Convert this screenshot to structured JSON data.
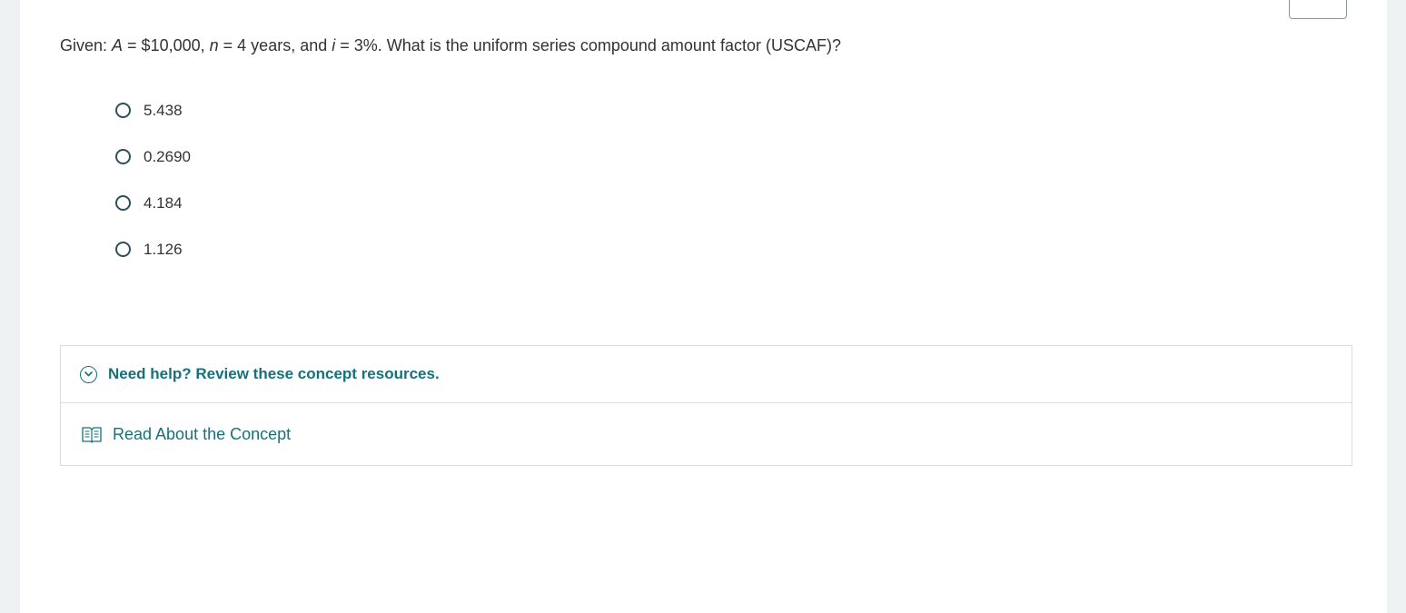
{
  "question": {
    "prefix": "Given: ",
    "var_a": "A",
    "part_a": " = $10,000, ",
    "var_n": "n",
    "part_n": " = 4 years, and ",
    "var_i": "i",
    "part_i": " = 3%. What is the uniform series compound amount factor (USCAF)?"
  },
  "options": [
    {
      "label": "5.438"
    },
    {
      "label": "0.2690"
    },
    {
      "label": "4.184"
    },
    {
      "label": "1.126"
    }
  ],
  "help": {
    "title": "Need help? Review these concept resources.",
    "link_label": "Read About the Concept"
  },
  "colors": {
    "accent": "#17707a",
    "radio": "#2f4f5a",
    "page_bg": "#eef2f3"
  },
  "icons": {
    "expand": "chevron-down-circle-icon",
    "book": "open-book-icon"
  }
}
